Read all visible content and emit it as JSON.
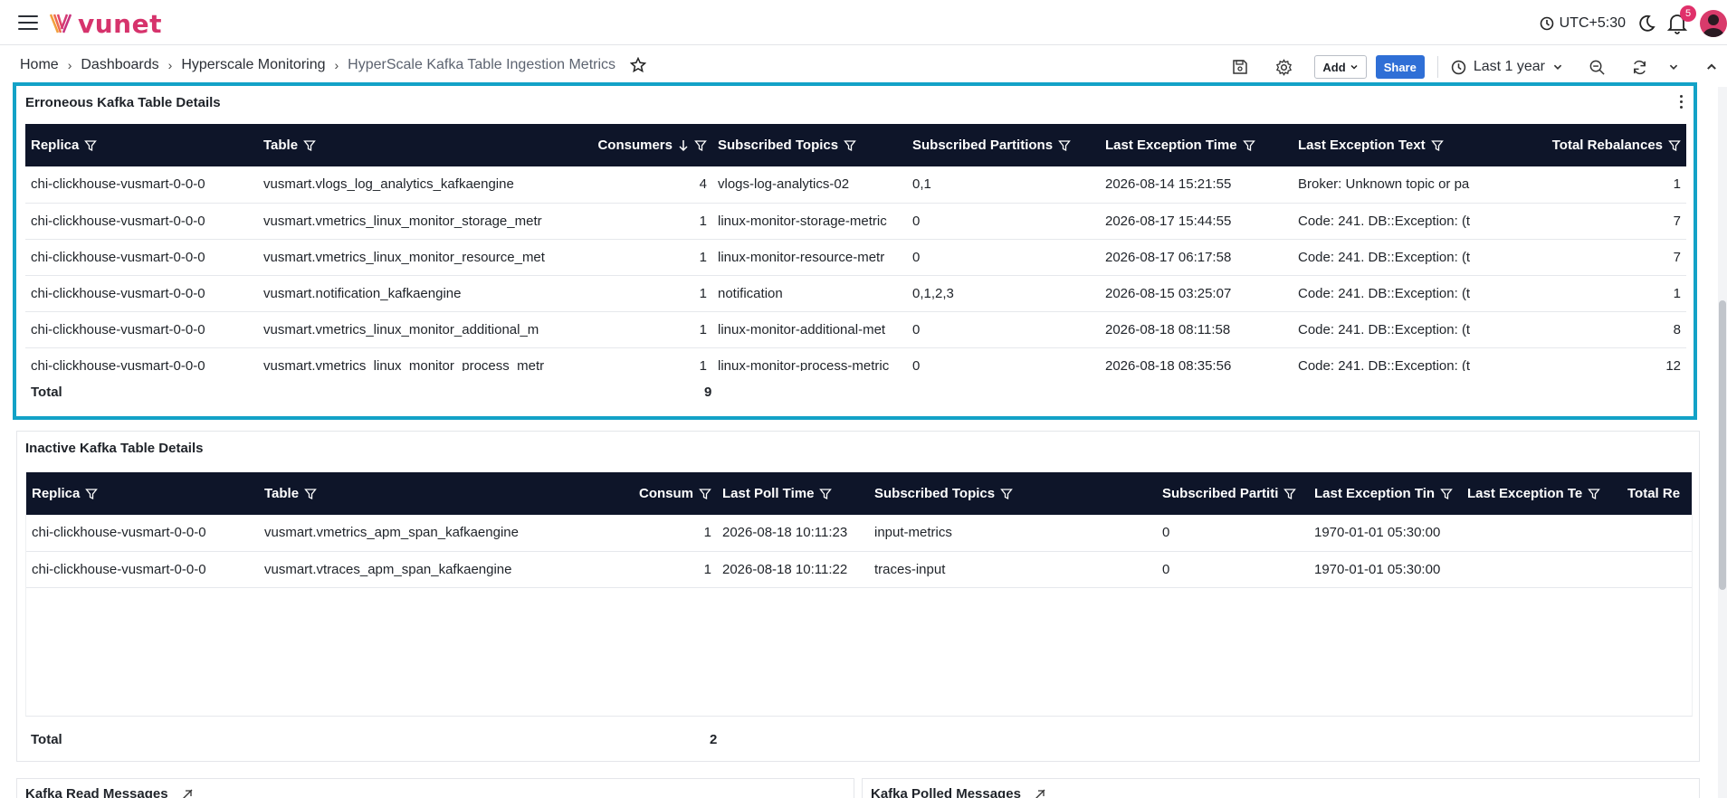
{
  "app": {
    "logo_text": "vunet"
  },
  "header": {
    "timezone": "UTC+5:30",
    "notifications_count": "5"
  },
  "breadcrumb": [
    "Home",
    "Dashboards",
    "Hyperscale Monitoring",
    "HyperScale Kafka Table Ingestion Metrics"
  ],
  "toolbar": {
    "add_label": "Add",
    "share_label": "Share",
    "time_range": "Last 1 year"
  },
  "erroneous": {
    "title": "Erroneous Kafka Table Details",
    "columns": [
      "Replica",
      "Table",
      "Consumers",
      "Subscribed Topics",
      "Subscribed Partitions",
      "Last Exception Time",
      "Last Exception Text",
      "Total Rebalances"
    ],
    "rows": [
      [
        "chi-clickhouse-vusmart-0-0-0",
        "vusmart.vlogs_log_analytics_kafkaengine",
        "4",
        "vlogs-log-analytics-02",
        "0,1",
        "2026-08-14 15:21:55",
        "Broker: Unknown topic or pa",
        "1"
      ],
      [
        "chi-clickhouse-vusmart-0-0-0",
        "vusmart.vmetrics_linux_monitor_storage_metr",
        "1",
        "linux-monitor-storage-metric",
        "0",
        "2026-08-17 15:44:55",
        "Code: 241. DB::Exception: (t",
        "7"
      ],
      [
        "chi-clickhouse-vusmart-0-0-0",
        "vusmart.vmetrics_linux_monitor_resource_met",
        "1",
        "linux-monitor-resource-metr",
        "0",
        "2026-08-17 06:17:58",
        "Code: 241. DB::Exception: (t",
        "7"
      ],
      [
        "chi-clickhouse-vusmart-0-0-0",
        "vusmart.notification_kafkaengine",
        "1",
        "notification",
        "0,1,2,3",
        "2026-08-15 03:25:07",
        "Code: 241. DB::Exception: (t",
        "1"
      ],
      [
        "chi-clickhouse-vusmart-0-0-0",
        "vusmart.vmetrics_linux_monitor_additional_m",
        "1",
        "linux-monitor-additional-met",
        "0",
        "2026-08-18 08:11:58",
        "Code: 241. DB::Exception: (t",
        "8"
      ],
      [
        "chi-clickhouse-vusmart-0-0-0",
        "vusmart.vmetrics_linux_monitor_process_metr",
        "1",
        "linux-monitor-process-metric",
        "0",
        "2026-08-18 08:35:56",
        "Code: 241. DB::Exception: (t",
        "12"
      ]
    ],
    "total_label": "Total",
    "total_value": "9"
  },
  "inactive": {
    "title": "Inactive Kafka Table Details",
    "columns": [
      "Replica",
      "Table",
      "Consum",
      "Last Poll Time",
      "Subscribed Topics",
      "Subscribed Partiti",
      "Last Exception Tin",
      "Last Exception Te",
      "Total Re"
    ],
    "rows": [
      [
        "chi-clickhouse-vusmart-0-0-0",
        "vusmart.vmetrics_apm_span_kafkaengine",
        "1",
        "2026-08-18 10:11:23",
        "input-metrics",
        "0",
        "1970-01-01 05:30:00",
        "",
        ""
      ],
      [
        "chi-clickhouse-vusmart-0-0-0",
        "vusmart.vtraces_apm_span_kafkaengine",
        "1",
        "2026-08-18 10:11:22",
        "traces-input",
        "0",
        "1970-01-01 05:30:00",
        "",
        ""
      ]
    ],
    "total_label": "Total",
    "total_value": "2"
  },
  "bottom_panels": {
    "left_title": "Kafka Read Messages",
    "right_title": "Kafka Polled Messages"
  }
}
